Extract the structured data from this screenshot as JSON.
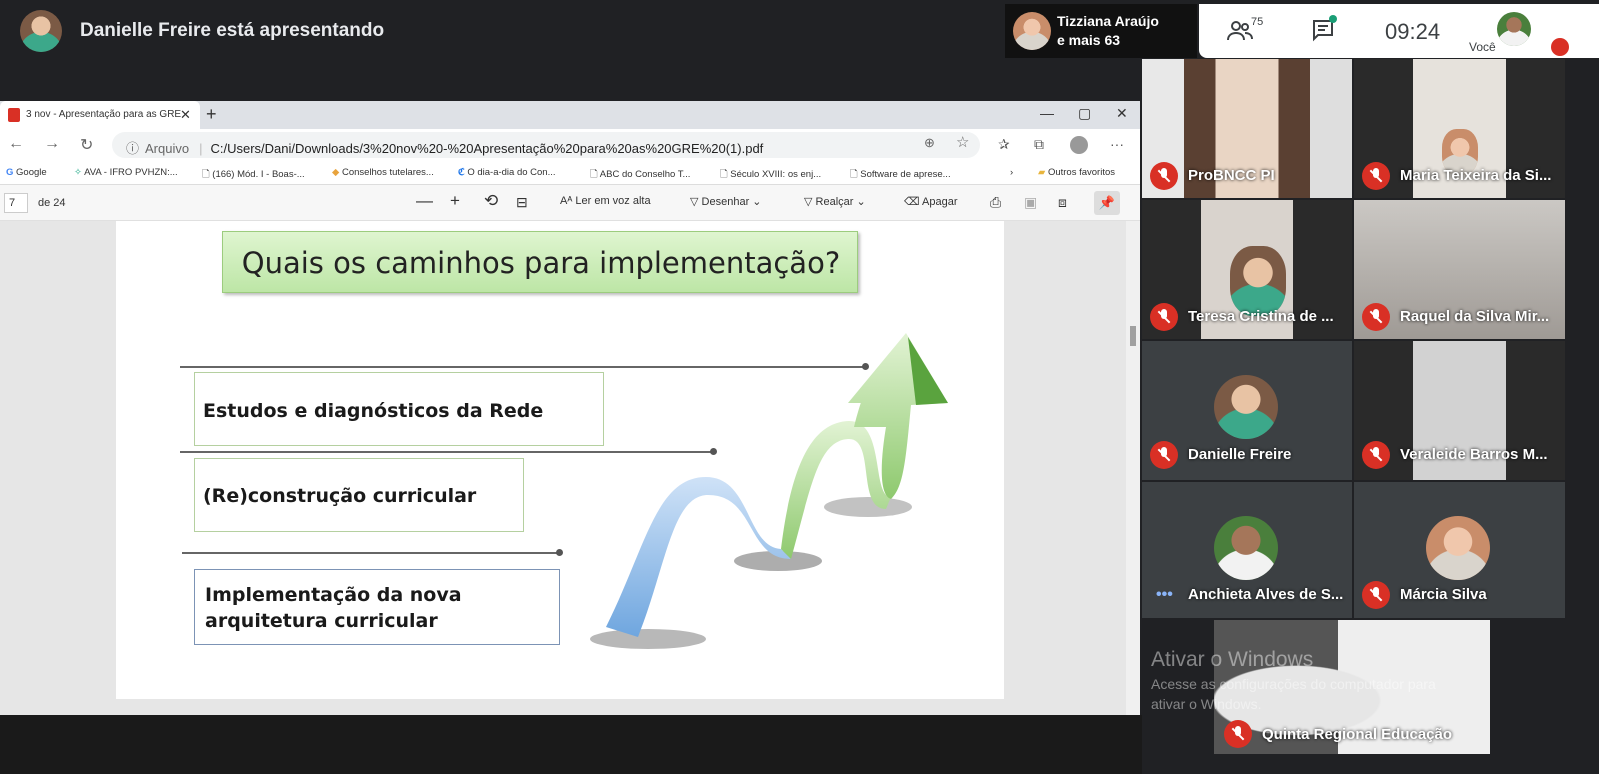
{
  "meet": {
    "presenter_banner": "Danielle Freire está apresentando",
    "speaker": {
      "name": "Tizziana Araújo",
      "more": "e mais 63"
    },
    "people_count": "75",
    "clock": "09:24",
    "self_label": "Você"
  },
  "browser": {
    "tab_title": "3 nov - Apresentação para as GRE",
    "address_prefix": "Arquivo",
    "url": "C:/Users/Dani/Downloads/3%20nov%20-%20Apresentação%20para%20as%20GRE%20(1).pdf",
    "bookmarks": [
      "Google",
      "AVA - IFRO PVHZN:...",
      "(166) Mód. I - Boas-...",
      "Conselhos tutelares...",
      "O dia-a-dia do Con...",
      "ABC do Conselho T...",
      "Século XVIII: os enj...",
      "Software de aprese..."
    ],
    "other_favorites": "Outros favoritos"
  },
  "pdf_toolbar": {
    "page": "7",
    "total": "de 24",
    "read_aloud": "Ler em voz alta",
    "draw": "Desenhar",
    "highlight": "Realçar",
    "erase": "Apagar"
  },
  "slide": {
    "title": "Quais os caminhos para implementação?",
    "items": [
      "Estudos e diagnósticos da Rede",
      "(Re)construção curricular",
      "Implementação da nova",
      "arquitetura curricular"
    ]
  },
  "participants": [
    {
      "name": "ProBNCC PI"
    },
    {
      "name": "Maria Teixeira da Si..."
    },
    {
      "name": "Teresa Cristina de ..."
    },
    {
      "name": "Raquel da Silva Mir..."
    },
    {
      "name": "Danielle Freire"
    },
    {
      "name": "Veraleide Barros M..."
    },
    {
      "name": "Anchieta Alves de S..."
    },
    {
      "name": "Márcia Silva"
    },
    {
      "name": "Quinta Regional Educação"
    }
  ],
  "watermark": {
    "title": "Ativar o Windows",
    "line1": "Acesse as configurações do computador para",
    "line2": "ativar o Windows."
  },
  "colors": {
    "accent_red": "#d93025",
    "slide_green": "#bde6a6",
    "dark_bg": "#202124"
  }
}
